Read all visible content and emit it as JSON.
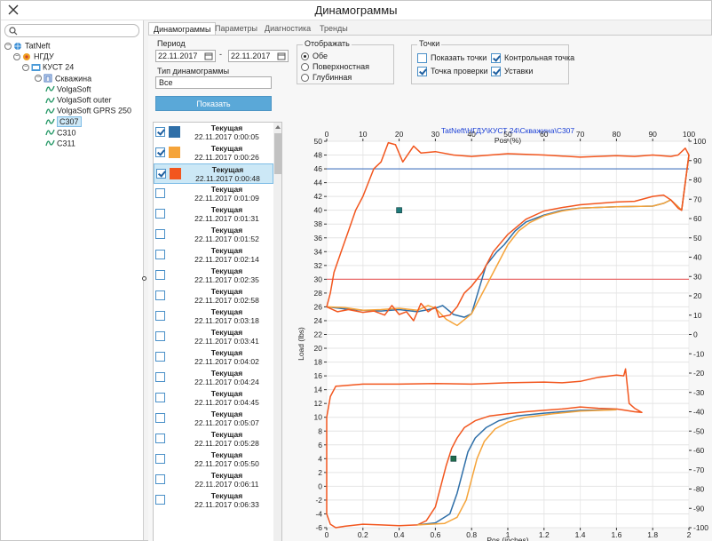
{
  "window": {
    "title": "Динамограммы"
  },
  "icons": {
    "close": "close-icon",
    "search": "search-icon",
    "calendar": "calendar-icon"
  },
  "tree": [
    {
      "label": "TatNeft",
      "icon": "globe-icon",
      "toggle": "−",
      "level": 0
    },
    {
      "label": "НГДУ",
      "icon": "org-icon",
      "toggle": "−",
      "level": 1
    },
    {
      "label": "КУСТ 24",
      "icon": "cluster-icon",
      "toggle": "−",
      "level": 2
    },
    {
      "label": "Скважина",
      "icon": "well-icon",
      "toggle": "−",
      "level": 3
    },
    {
      "label": "VolgaSoft",
      "icon": "sensor-icon",
      "toggle": "",
      "level": 4
    },
    {
      "label": "VolgaSoft outer",
      "icon": "sensor-icon",
      "toggle": "",
      "level": 4
    },
    {
      "label": "VolgaSoft GPRS 250",
      "icon": "sensor-icon",
      "toggle": "",
      "level": 4
    },
    {
      "label": "С307",
      "icon": "sensor-icon",
      "toggle": "",
      "level": 4,
      "selected": true
    },
    {
      "label": "С310",
      "icon": "sensor-icon",
      "toggle": "",
      "level": 4
    },
    {
      "label": "С311",
      "icon": "sensor-icon",
      "toggle": "",
      "level": 4
    }
  ],
  "tabs": [
    {
      "label": "Динамограммы",
      "active": true
    },
    {
      "label": "Параметры",
      "active": false
    },
    {
      "label": "Диагностика",
      "active": false
    },
    {
      "label": "Тренды",
      "active": false
    }
  ],
  "period": {
    "label": "Период",
    "from": "22.11.2017",
    "to": "22.11.2017",
    "dash": "-"
  },
  "dyn_type": {
    "label": "Тип динамограммы",
    "value": "Все"
  },
  "show_button": "Показать",
  "display": {
    "title": "Отображать",
    "options": [
      {
        "label": "Обе",
        "selected": true
      },
      {
        "label": "Поверхностная",
        "selected": false
      },
      {
        "label": "Глубинная",
        "selected": false
      }
    ]
  },
  "points": {
    "title": "Точки",
    "items": [
      {
        "label": "Показать точки",
        "checked": false
      },
      {
        "label": "Контрольная точка",
        "checked": true
      },
      {
        "label": "Точка проверки",
        "checked": true
      },
      {
        "label": "Уставки",
        "checked": true
      }
    ]
  },
  "measurements": [
    {
      "title": "Текущая",
      "time": "22.11.2017 0:00:05",
      "checked": true,
      "color": "#2f6fa8"
    },
    {
      "title": "Текущая",
      "time": "22.11.2017 0:00:26",
      "checked": true,
      "color": "#f5a43a"
    },
    {
      "title": "Текущая",
      "time": "22.11.2017 0:00:48",
      "checked": true,
      "color": "#f2561e",
      "selected": true
    },
    {
      "title": "Текущая",
      "time": "22.11.2017 0:01:09",
      "checked": false
    },
    {
      "title": "Текущая",
      "time": "22.11.2017 0:01:31",
      "checked": false
    },
    {
      "title": "Текущая",
      "time": "22.11.2017 0:01:52",
      "checked": false
    },
    {
      "title": "Текущая",
      "time": "22.11.2017 0:02:14",
      "checked": false
    },
    {
      "title": "Текущая",
      "time": "22.11.2017 0:02:35",
      "checked": false
    },
    {
      "title": "Текущая",
      "time": "22.11.2017 0:02:58",
      "checked": false
    },
    {
      "title": "Текущая",
      "time": "22.11.2017 0:03:18",
      "checked": false
    },
    {
      "title": "Текущая",
      "time": "22.11.2017 0:03:41",
      "checked": false
    },
    {
      "title": "Текущая",
      "time": "22.11.2017 0:04:02",
      "checked": false
    },
    {
      "title": "Текущая",
      "time": "22.11.2017 0:04:24",
      "checked": false
    },
    {
      "title": "Текущая",
      "time": "22.11.2017 0:04:45",
      "checked": false
    },
    {
      "title": "Текущая",
      "time": "22.11.2017 0:05:07",
      "checked": false
    },
    {
      "title": "Текущая",
      "time": "22.11.2017 0:05:28",
      "checked": false
    },
    {
      "title": "Текущая",
      "time": "22.11.2017 0:05:50",
      "checked": false
    },
    {
      "title": "Текущая",
      "time": "22.11.2017 0:06:11",
      "checked": false
    },
    {
      "title": "Текущая",
      "time": "22.11.2017 0:06:33",
      "checked": false
    }
  ],
  "chart_data": {
    "type": "line",
    "title": "TatNeft\\НГДУ\\КУСТ 24\\Скважина\\С307",
    "top_axis_label": "Pos (%)",
    "bottom_axis_label": "Pos (inches)",
    "left_axis_label": "Load (lbs)",
    "top_axis": {
      "min": 0,
      "max": 100,
      "ticks": [
        0,
        10,
        20,
        30,
        40,
        50,
        60,
        70,
        80,
        90,
        100
      ]
    },
    "bottom_axis": {
      "min": 0,
      "max": 2,
      "ticks": [
        0,
        0.2,
        0.4,
        0.6,
        0.8,
        1,
        1.2,
        1.4,
        1.6,
        1.8,
        2
      ]
    },
    "left_axis": {
      "min": -6,
      "max": 50,
      "ticks": [
        -6,
        -4,
        -2,
        0,
        2,
        4,
        6,
        8,
        10,
        12,
        14,
        16,
        18,
        20,
        22,
        24,
        26,
        28,
        30,
        32,
        34,
        36,
        38,
        40,
        42,
        44,
        46,
        48,
        50
      ]
    },
    "right_axis": {
      "min": -100,
      "max": 100,
      "ticks": [
        -100,
        -90,
        -80,
        -70,
        -60,
        -50,
        -40,
        -30,
        -20,
        -10,
        0,
        10,
        20,
        30,
        40,
        50,
        60,
        70,
        80,
        90,
        100
      ]
    },
    "grid": true,
    "reference_lines": [
      {
        "y": 46,
        "color": "#4a78c2"
      },
      {
        "y": 30,
        "color": "#e96b6b"
      }
    ],
    "markers": [
      {
        "pos_pct": 20,
        "load": 40,
        "color": "#1f7a7a"
      },
      {
        "pos_in": 0.7,
        "load": 4,
        "color": "#1f6b4a"
      }
    ],
    "series": [
      {
        "color": "#2f6fa8",
        "axis": "surface",
        "points": [
          [
            0,
            26
          ],
          [
            5,
            25.7
          ],
          [
            10,
            25.5
          ],
          [
            15,
            25.4
          ],
          [
            20,
            25.6
          ],
          [
            25,
            25.3
          ],
          [
            30,
            25.8
          ],
          [
            32,
            26.2
          ],
          [
            35,
            24.9
          ],
          [
            38,
            24.5
          ],
          [
            40,
            25
          ],
          [
            44,
            32
          ],
          [
            47,
            34
          ],
          [
            49,
            35
          ],
          [
            52,
            37
          ],
          [
            55,
            38.3
          ],
          [
            60,
            39.3
          ],
          [
            65,
            40
          ],
          [
            70,
            40.3
          ],
          [
            80,
            40.5
          ],
          [
            90,
            40.6
          ],
          [
            93,
            41
          ],
          [
            95,
            41.5
          ],
          [
            97,
            40.5
          ],
          [
            98,
            40
          ],
          [
            99,
            44
          ],
          [
            100,
            48
          ]
        ]
      },
      {
        "color": "#f5a43a",
        "axis": "surface",
        "points": [
          [
            0,
            26
          ],
          [
            5,
            25.9
          ],
          [
            10,
            25.5
          ],
          [
            15,
            25.6
          ],
          [
            20,
            25.8
          ],
          [
            25,
            25.5
          ],
          [
            28,
            26.2
          ],
          [
            30,
            25.8
          ],
          [
            33,
            24.2
          ],
          [
            36,
            23.3
          ],
          [
            40,
            25
          ],
          [
            45,
            30
          ],
          [
            48,
            33
          ],
          [
            50,
            35
          ],
          [
            53,
            37
          ],
          [
            56,
            38.2
          ],
          [
            60,
            39.2
          ],
          [
            65,
            39.9
          ],
          [
            70,
            40.3
          ],
          [
            80,
            40.5
          ],
          [
            90,
            40.6
          ],
          [
            93,
            41
          ],
          [
            95,
            41.5
          ],
          [
            97,
            40.5
          ],
          [
            98,
            40
          ],
          [
            99,
            44
          ],
          [
            100,
            48
          ]
        ]
      },
      {
        "color": "#f2561e",
        "axis": "surface",
        "points": [
          [
            0,
            26
          ],
          [
            3,
            25.3
          ],
          [
            6,
            25.6
          ],
          [
            10,
            25.2
          ],
          [
            13,
            25.4
          ],
          [
            16,
            24.8
          ],
          [
            18,
            26.2
          ],
          [
            20,
            24.9
          ],
          [
            22,
            25.3
          ],
          [
            24,
            24
          ],
          [
            26,
            26.5
          ],
          [
            28,
            25.3
          ],
          [
            30,
            26
          ],
          [
            31,
            24.5
          ],
          [
            34,
            24.8
          ],
          [
            36,
            26
          ],
          [
            38,
            28
          ],
          [
            40,
            29
          ],
          [
            43,
            31
          ],
          [
            46,
            34
          ],
          [
            50,
            36.5
          ],
          [
            55,
            38.7
          ],
          [
            60,
            39.9
          ],
          [
            65,
            40.4
          ],
          [
            70,
            40.8
          ],
          [
            80,
            41.2
          ],
          [
            85,
            41.3
          ],
          [
            90,
            42
          ],
          [
            93,
            42.2
          ],
          [
            95,
            41.5
          ],
          [
            97,
            40.3
          ],
          [
            98,
            40
          ],
          [
            99,
            44
          ],
          [
            100,
            48
          ],
          [
            99,
            49
          ],
          [
            97,
            48
          ],
          [
            95,
            47.8
          ],
          [
            90,
            48
          ],
          [
            85,
            47.8
          ],
          [
            80,
            47.9
          ],
          [
            70,
            47.7
          ],
          [
            60,
            48
          ],
          [
            50,
            48.2
          ],
          [
            40,
            47.8
          ],
          [
            35,
            48
          ],
          [
            30,
            48.5
          ],
          [
            26,
            48.3
          ],
          [
            24,
            49.3
          ],
          [
            21,
            47
          ],
          [
            19,
            49.5
          ],
          [
            17,
            49.8
          ],
          [
            15,
            47
          ],
          [
            13,
            46
          ],
          [
            10,
            42
          ],
          [
            8,
            40
          ],
          [
            6,
            37
          ],
          [
            4,
            34
          ],
          [
            2,
            31
          ],
          [
            1,
            28
          ],
          [
            0,
            26
          ]
        ]
      },
      {
        "color": "#f2561e",
        "axis": "downhole",
        "points": [
          [
            0,
            -4
          ],
          [
            0.02,
            -5.5
          ],
          [
            0.05,
            -6
          ],
          [
            0.1,
            -5.8
          ],
          [
            0.2,
            -5.5
          ],
          [
            0.3,
            -5.6
          ],
          [
            0.4,
            -5.7
          ],
          [
            0.5,
            -5.6
          ],
          [
            0.55,
            -5
          ],
          [
            0.6,
            -3
          ],
          [
            0.63,
            0
          ],
          [
            0.66,
            3
          ],
          [
            0.69,
            5.5
          ],
          [
            0.72,
            7
          ],
          [
            0.76,
            8.5
          ],
          [
            0.82,
            9.5
          ],
          [
            0.9,
            10.2
          ],
          [
            1.0,
            10.5
          ],
          [
            1.1,
            10.8
          ],
          [
            1.2,
            11
          ],
          [
            1.3,
            11.2
          ],
          [
            1.4,
            11.5
          ],
          [
            1.5,
            11.3
          ],
          [
            1.6,
            11.2
          ],
          [
            1.65,
            11
          ],
          [
            1.7,
            10.8
          ],
          [
            1.74,
            10.7
          ],
          [
            1.7,
            11.3
          ],
          [
            1.67,
            12
          ],
          [
            1.65,
            17
          ],
          [
            1.64,
            16
          ],
          [
            1.6,
            16.1
          ],
          [
            1.5,
            15.8
          ],
          [
            1.4,
            15.2
          ],
          [
            1.3,
            15
          ],
          [
            1.2,
            15.1
          ],
          [
            1.0,
            15
          ],
          [
            0.8,
            14.8
          ],
          [
            0.6,
            14.9
          ],
          [
            0.4,
            14.8
          ],
          [
            0.2,
            14.8
          ],
          [
            0.05,
            14.5
          ],
          [
            0.02,
            13
          ],
          [
            0,
            10
          ],
          [
            0,
            -4
          ]
        ]
      },
      {
        "color": "#2f6fa8",
        "axis": "downhole",
        "points": [
          [
            0.5,
            -5.6
          ],
          [
            0.6,
            -5.3
          ],
          [
            0.68,
            -4
          ],
          [
            0.72,
            -1
          ],
          [
            0.75,
            2
          ],
          [
            0.78,
            5
          ],
          [
            0.82,
            7
          ],
          [
            0.88,
            8.5
          ],
          [
            0.95,
            9.5
          ],
          [
            1.05,
            10.2
          ],
          [
            1.2,
            10.6
          ],
          [
            1.4,
            11
          ],
          [
            1.6,
            11.1
          ]
        ]
      },
      {
        "color": "#f5a43a",
        "axis": "downhole",
        "points": [
          [
            0.5,
            -5.6
          ],
          [
            0.65,
            -5.4
          ],
          [
            0.72,
            -4.5
          ],
          [
            0.77,
            -2
          ],
          [
            0.8,
            1
          ],
          [
            0.83,
            4
          ],
          [
            0.87,
            6.5
          ],
          [
            0.93,
            8.3
          ],
          [
            1.0,
            9.3
          ],
          [
            1.1,
            10
          ],
          [
            1.25,
            10.5
          ],
          [
            1.4,
            10.9
          ],
          [
            1.6,
            11.1
          ]
        ]
      }
    ]
  }
}
